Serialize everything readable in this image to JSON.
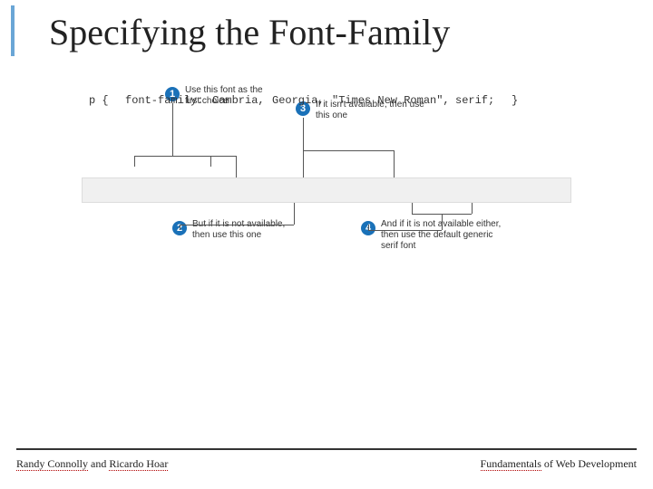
{
  "slide": {
    "title": "Specifying the Font-Family"
  },
  "code": {
    "selector": "p {",
    "property": "font-family:",
    "font1": "Cambria,",
    "font2": "Georgia,",
    "font3": "\"Times New Roman\",",
    "font4": "serif;",
    "close": "}"
  },
  "annotations": {
    "a1": {
      "num": "1",
      "text": "Use this font as the first choice"
    },
    "a2": {
      "num": "2",
      "text": "But if it is not available, then use this one"
    },
    "a3": {
      "num": "3",
      "text": "If it isn't available, then use this one"
    },
    "a4": {
      "num": "4",
      "text": "And if it is not available either, then use the default generic serif font"
    }
  },
  "footer": {
    "author1": "Randy Connolly",
    "and": " and ",
    "author2": "Ricardo Hoar",
    "book_word1": "Fundamentals",
    "book_rest": " of Web Development"
  }
}
